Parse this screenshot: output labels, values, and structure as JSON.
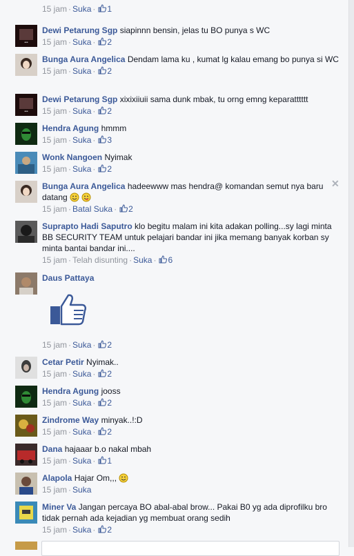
{
  "top_partial": {
    "time": "15 jam",
    "like_label": "Suka",
    "like_count": "1"
  },
  "comments": [
    {
      "author": "Dewi Petarung Sgp",
      "text": "siapinnn bensin, jelas tu BO punya s WC",
      "time": "15 jam",
      "like_label": "Suka",
      "like_count": "2"
    },
    {
      "author": "Bunga Aura Angelica",
      "text": "Dendam lama ku , kumat lg kalau emang bo punya si WC",
      "time": "15 jam",
      "like_label": "Suka",
      "like_count": "2"
    },
    {
      "author": "Dewi Petarung Sgp",
      "text": "xixixiiuii sama dunk mbak, tu orng emng keparatttttt",
      "time": "15 jam",
      "like_label": "Suka",
      "like_count": "2"
    },
    {
      "author": "Hendra Agung",
      "text": "hmmm",
      "time": "15 jam",
      "like_label": "Suka",
      "like_count": "3"
    },
    {
      "author": "Wonk Nangoen",
      "text": "Nyimak",
      "time": "15 jam",
      "like_label": "Suka",
      "like_count": "2"
    },
    {
      "author": "Bunga Aura Angelica",
      "text": "hadeewww mas hendra@ komandan semut nya baru datang",
      "time": "15 jam",
      "like_label": "Batal Suka",
      "like_count": "2"
    },
    {
      "author": "Suprapto Hadi Saputro",
      "text": "klo begitu malam ini kita adakan polling...sy lagi minta BB SECURITY TEAM untuk pelajari bandar ini jika memang banyak korban sy minta bantai bandar ini....",
      "time": "15 jam",
      "edited": "Telah disunting",
      "like_label": "Suka",
      "like_count": "6"
    },
    {
      "author": "Daus Pattaya",
      "text": "",
      "time": "15 jam",
      "like_label": "Suka",
      "like_count": "2"
    },
    {
      "author": "Cetar Petir",
      "text": "Nyimak..",
      "time": "15 jam",
      "like_label": "Suka",
      "like_count": "2"
    },
    {
      "author": "Hendra Agung",
      "text": "jooss",
      "time": "15 jam",
      "like_label": "Suka",
      "like_count": "2"
    },
    {
      "author": "Zindrome Way",
      "text": "minyak..!:D",
      "time": "15 jam",
      "like_label": "Suka",
      "like_count": "2"
    },
    {
      "author": "Dana",
      "text": "hajaaar b.o nakal mbah",
      "time": "15 jam",
      "like_label": "Suka",
      "like_count": "1"
    },
    {
      "author": "Alapola",
      "text": "Hajar Om,,,",
      "time": "15 jam",
      "like_label": "Suka",
      "like_count": ""
    },
    {
      "author": "Miner Va",
      "text": "Jangan percaya BO abal-abal brow... Pakai B0 yg ada diprofilku bro tidak pernah ada kejadian yg membuat orang sedih",
      "time": "15 jam",
      "like_label": "Suka",
      "like_count": "2"
    }
  ],
  "icons": {
    "like": "thumbs-up-icon",
    "close": "close-icon",
    "smile": "smile-emoji-icon",
    "tongue": "tongue-emoji-icon"
  },
  "colors": {
    "link": "#3b5998",
    "meta": "#90949c",
    "text": "#141823"
  }
}
